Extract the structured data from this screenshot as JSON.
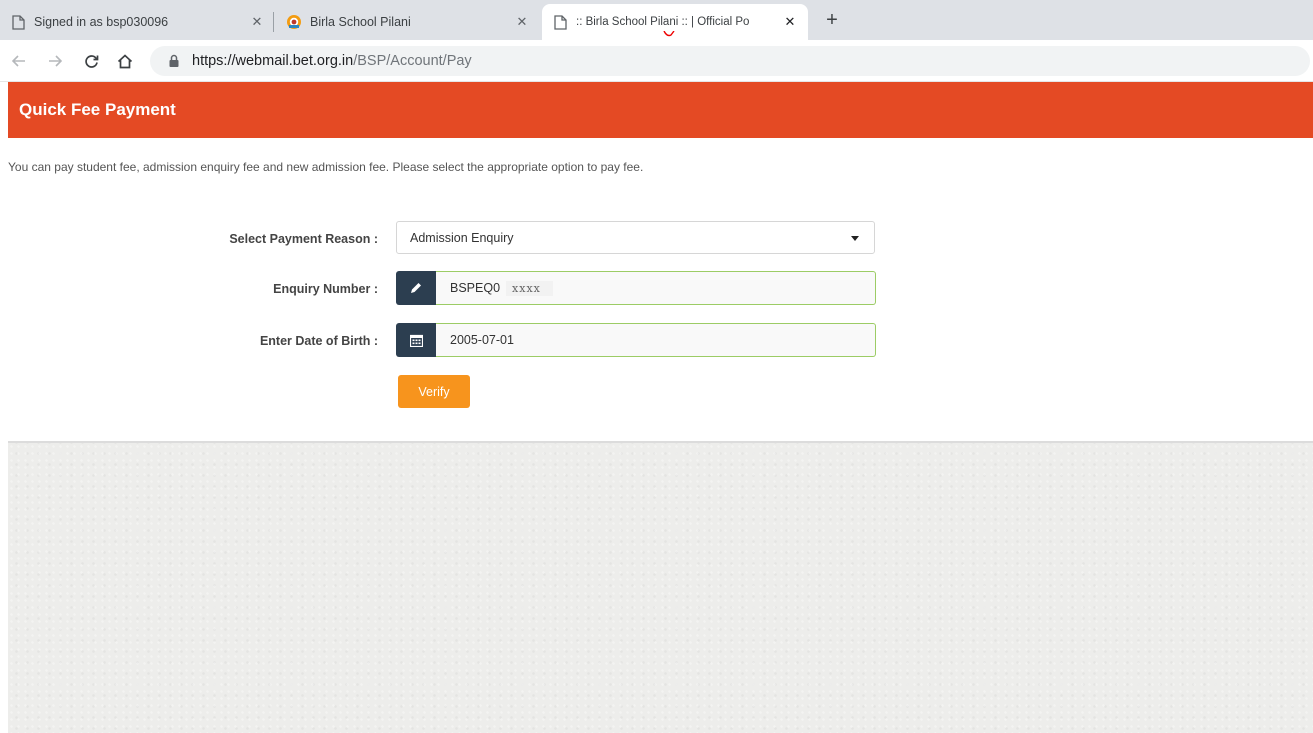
{
  "browser": {
    "tabs": [
      {
        "label": "Signed in as bsp030096",
        "icon": "page-icon",
        "active": false
      },
      {
        "label": "Birla School Pilani",
        "icon": "school-logo-icon",
        "active": false
      },
      {
        "label": ":: Birla School Pilani :: | Official Po",
        "icon": "page-icon",
        "active": true
      }
    ],
    "close_glyph": "✕",
    "new_tab_glyph": "+",
    "url_host": "https://webmail.bet.org.in",
    "url_path": "/BSP/Account/Pay"
  },
  "page": {
    "title": "Quick Fee Payment",
    "intro": "You can pay student fee, admission enquiry fee and new admission fee. Please select the appropriate option to pay fee.",
    "form": {
      "payment_reason_label": "Select Payment Reason :",
      "payment_reason_value": "Admission Enquiry",
      "enquiry_label": "Enquiry Number :",
      "enquiry_value": "BSPEQ0",
      "enquiry_redacted": "xxxx",
      "dob_label": "Enter Date of Birth :",
      "dob_value": "2005-07-01",
      "verify_label": "Verify"
    }
  },
  "colors": {
    "header_bg": "#e44a24",
    "verify_bg": "#f7941d",
    "addon_bg": "#2c3e50",
    "valid_border": "#9ccc65"
  }
}
